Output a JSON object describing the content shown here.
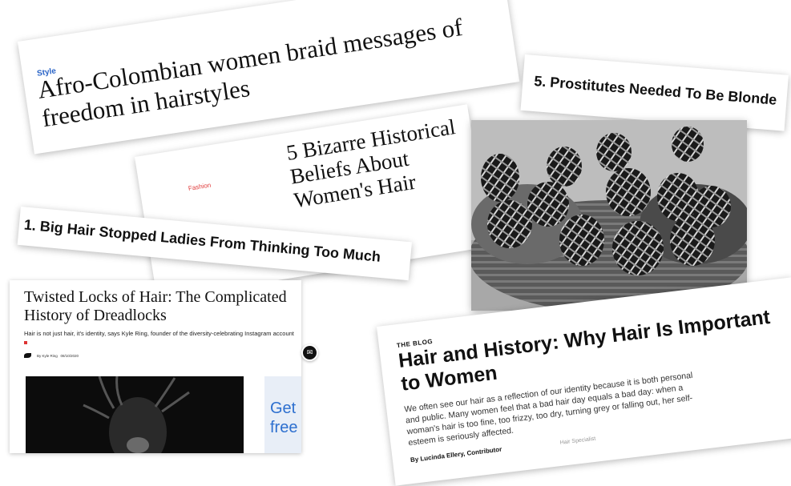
{
  "clip_afro": {
    "tag": "Style",
    "title": "Afro-Colombian women braid messages of freedom in hairstyles"
  },
  "clip_blonde": {
    "title": "5. Prostitutes Needed To Be Blonde"
  },
  "clip_bizarre": {
    "tag": "Fashion",
    "title": "5 Bizarre Historical Beliefs About Women's Hair"
  },
  "clip_bighair": {
    "title": "1. Big Hair Stopped Ladies From Thinking Too Much"
  },
  "clip_dreadlocks": {
    "title": "Twisted Locks of Hair: The Complicated History of Dreadlocks",
    "subtitle": "Hair is not just hair, it's identity, says Kyle Ring, founder of the diversity-celebrating Instagram account",
    "author": "By Kyle Ring",
    "date": "08/10/2020",
    "ad_text": "Get free"
  },
  "clip_blog": {
    "tag": "THE BLOG",
    "title": "Hair and History: Why Hair Is Important to Women",
    "body": "We often see our hair as a reflection of our identity because it is both personal and public. Many women feel that a bad hair day equals a bad day: when a woman's hair is too fine, too frizzy, too dry, turning grey or falling out, her self-esteem is seriously affected.",
    "byline": "By Lucinda Ellery, Contributor",
    "byline_extra": "Hair Specialist"
  },
  "icons": {
    "mail": "envelope-icon"
  },
  "colors": {
    "style_tag": "#2a64c7",
    "fashion_tag": "#e03a3a",
    "ad_text": "#2d6fcf"
  }
}
